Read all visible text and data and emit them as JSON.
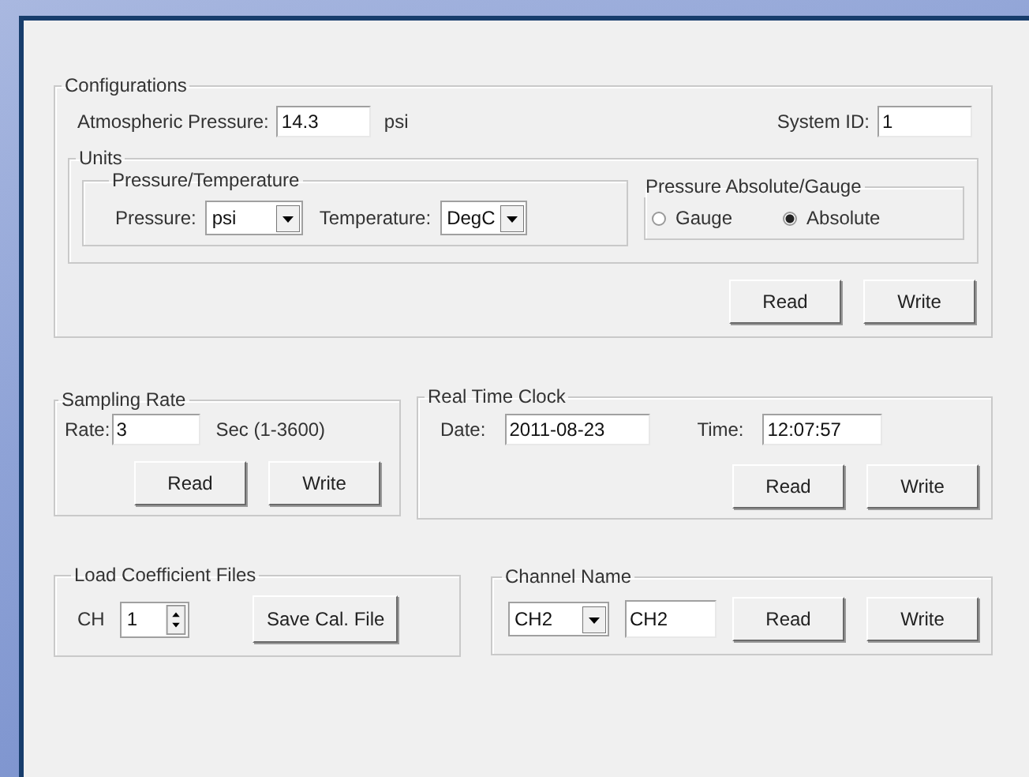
{
  "configurations": {
    "title": "Configurations",
    "atmospheric_pressure": {
      "label": "Atmospheric Pressure:",
      "value": "14.3",
      "unit": "psi"
    },
    "system_id": {
      "label": "System ID:",
      "value": "1"
    },
    "units": {
      "title": "Units",
      "pressure_temperature": {
        "title": "Pressure/Temperature",
        "pressure": {
          "label": "Pressure:",
          "value": "psi"
        },
        "temperature": {
          "label": "Temperature:",
          "value": "DegC"
        }
      },
      "pressure_mode": {
        "title": "Pressure Absolute/Gauge",
        "options": [
          {
            "label": "Gauge",
            "selected": false
          },
          {
            "label": "Absolute",
            "selected": true
          }
        ]
      }
    },
    "buttons": [
      "Read",
      "Write"
    ]
  },
  "sampling_rate": {
    "title": "Sampling Rate",
    "rate": {
      "label": "Rate:",
      "value": "3",
      "unit": "Sec (1-3600)"
    },
    "buttons": [
      "Read",
      "Write"
    ]
  },
  "real_time_clock": {
    "title": "Real Time Clock",
    "date": {
      "label": "Date:",
      "value": "2011-08-23"
    },
    "time": {
      "label": "Time:",
      "value": "12:07:57"
    },
    "buttons": [
      "Read",
      "Write"
    ]
  },
  "load_coefficient_files": {
    "title": "Load Coefficient Files",
    "channel": {
      "label": "CH",
      "value": "1"
    },
    "button": "Save Cal. File"
  },
  "channel_name": {
    "title": "Channel Name",
    "channel_select": {
      "value": "CH2"
    },
    "name_field": {
      "value": "CH2"
    },
    "buttons": [
      "Read",
      "Write"
    ]
  }
}
